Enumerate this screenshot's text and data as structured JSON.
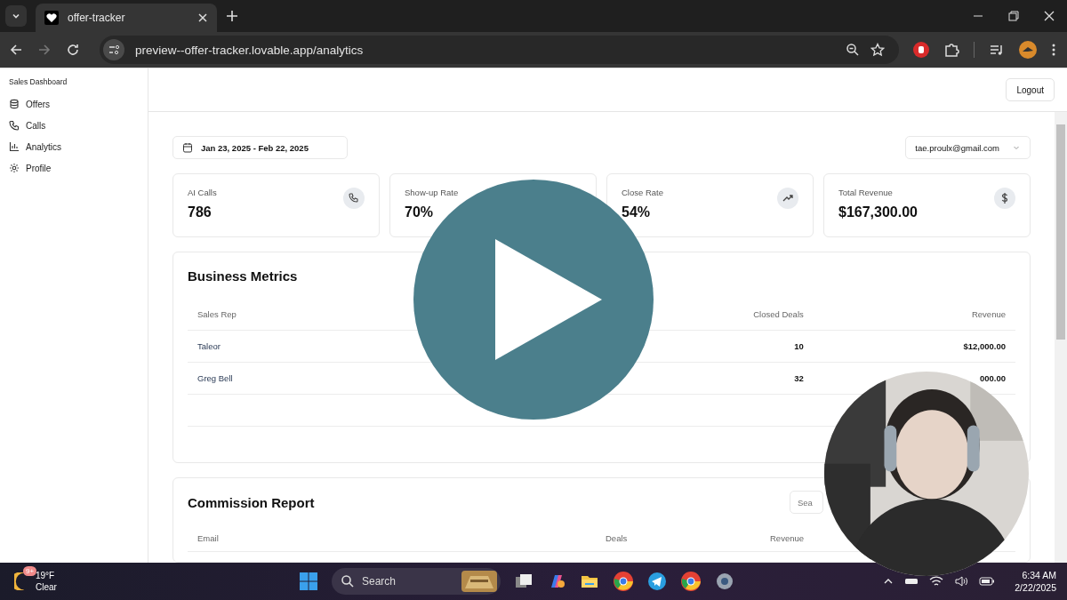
{
  "browser": {
    "tab_title": "offer-tracker",
    "url": "preview--offer-tracker.lovable.app/analytics"
  },
  "sidebar": {
    "title": "Sales Dashboard",
    "items": [
      {
        "label": "Offers",
        "kind": "offers"
      },
      {
        "label": "Calls",
        "kind": "calls"
      },
      {
        "label": "Analytics",
        "kind": "analytics"
      },
      {
        "label": "Profile",
        "kind": "profile"
      }
    ]
  },
  "header": {
    "logout": "Logout"
  },
  "date_range": "Jan 23, 2025 - Feb 22, 2025",
  "account": "tae.proulx@gmail.com",
  "stats": [
    {
      "label": "AI Calls",
      "value": "786",
      "kind": "phone"
    },
    {
      "label": "Show-up Rate",
      "value": "70%"
    },
    {
      "label": "Close Rate",
      "value": "54%",
      "kind": "trend"
    },
    {
      "label": "Total Revenue",
      "value": "$167,300.00",
      "kind": "dollar"
    }
  ],
  "business_metrics": {
    "title": "Business Metrics",
    "columns": [
      "Sales Rep",
      "Closed Deals",
      "Revenue"
    ],
    "rows": [
      [
        "Taleor",
        "10",
        "$12,000.00"
      ],
      [
        "Greg Bell",
        "32",
        "000.00"
      ]
    ]
  },
  "commission_report": {
    "title": "Commission Report",
    "search": {
      "placeholder": "Sea"
    },
    "columns": [
      "Email",
      "Deals",
      "Revenue"
    ]
  },
  "taskbar": {
    "badge": "9+",
    "temperature": "19°F",
    "condition": "Clear",
    "search": "Search",
    "time": "6:34 AM",
    "date": "2/22/2025"
  }
}
